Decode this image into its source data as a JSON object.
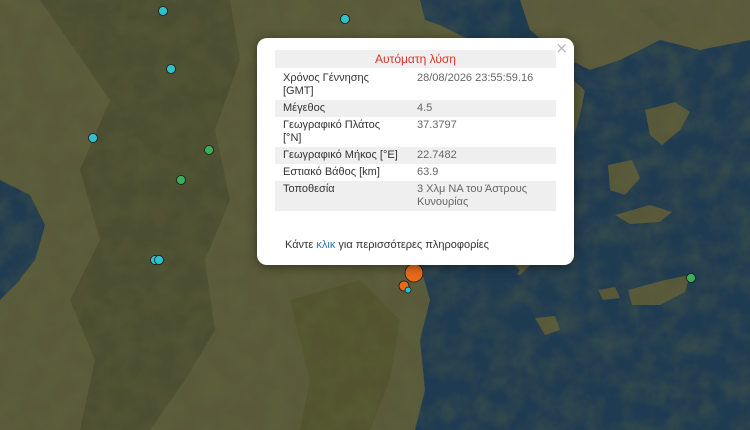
{
  "map": {
    "background_colors": {
      "sea": "#1f3b52",
      "land": "#59593a",
      "highland": "#4a4e30"
    },
    "markers": [
      {
        "color": "#2fc1cb"
      },
      {
        "color": "#2fc1cb"
      },
      {
        "color": "#2fc1cb"
      },
      {
        "color": "#2fc1cb"
      },
      {
        "color": "#3cae5a"
      },
      {
        "color": "#3cae5a"
      },
      {
        "color": "#2fc1cb"
      },
      {
        "color": "#2fc1cb"
      },
      {
        "color": "#3cae5a"
      },
      {
        "color": "#e86b1c"
      },
      {
        "color": "#e86b1c"
      },
      {
        "color": "#2fc1cb"
      }
    ]
  },
  "popup": {
    "close_label": "×",
    "title": "Αυτόματη λύση",
    "rows": [
      {
        "label": "Χρόνος Γέννησης [GMT]",
        "value": "28/08/2026 23:55:59.16"
      },
      {
        "label": "Μέγεθος",
        "value": "4.5"
      },
      {
        "label": "Γεωγραφικό Πλάτος [°N]",
        "value": "37.3797"
      },
      {
        "label": "Γεωγραφικό Μήκος [°E]",
        "value": "22.7482"
      },
      {
        "label": "Εστιακό Βάθος [km]",
        "value": "63.9"
      },
      {
        "label": "Τοποθεσία",
        "value": "3 Χλμ  ΝΑ του Άστρους Κυνουρίας"
      }
    ],
    "footer_prefix": "Κάντε ",
    "footer_link": "κλικ",
    "footer_suffix": " για περισσότερες πληροφορίες"
  }
}
